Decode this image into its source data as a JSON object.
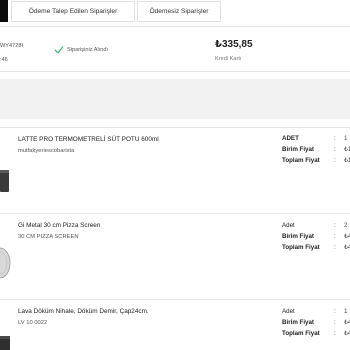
{
  "tabs": {
    "tab1": "Ödeme Talep Edilen Siparişler",
    "tab2": "Ödemesiz Siparişler"
  },
  "order": {
    "order_no_fragment": "WY4728I",
    "time_fragment": ":46",
    "status": "Siparişiniz Alındı",
    "amount": "₺335,85",
    "payment": "Kredi Kartı"
  },
  "labels": {
    "qty": "ADET",
    "unit_price": "Birim Fiyat",
    "total_price": "Toplam Fiyat",
    "qty_alt": "Adet",
    "colon": ":"
  },
  "products": [
    {
      "name": "LATTE PRO TERMOMETRELİ SÜT POTU 600ml",
      "sub": "mutfakyeriescobarista",
      "qty": "1",
      "unit": "₺1",
      "total": "₺1"
    },
    {
      "name": "Gi Metal 30 cm Pizza Screen",
      "sub": "30 CM PIZZA SCREEN",
      "qty": "2",
      "unit": "₺4",
      "total": "₺4"
    },
    {
      "name": "Lava Döküm Nihale, Döküm Demir, Çap24cm.",
      "sub": "LV 10 0022",
      "qty": "1",
      "unit": "₺4",
      "total": "₺4"
    }
  ],
  "icons": {
    "check": "check-icon",
    "thumb": "product-thumbnail"
  },
  "colors": {
    "check_green": "#3cb371",
    "active_tab": "#0b0b0b",
    "band": "#f2f2f2"
  }
}
